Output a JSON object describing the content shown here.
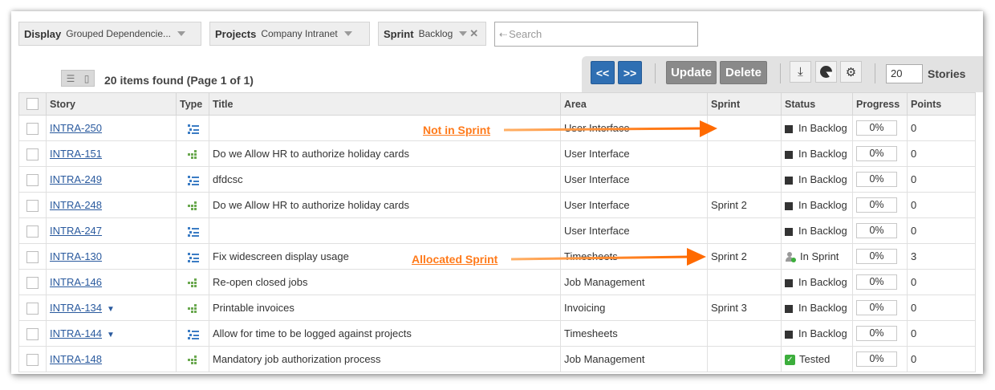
{
  "filters": {
    "display": {
      "label": "Display",
      "value": "Grouped Dependencie..."
    },
    "projects": {
      "label": "Projects",
      "value": "Company Intranet"
    },
    "sprint": {
      "label": "Sprint",
      "value": "Backlog"
    }
  },
  "search": {
    "placeholder": "Search"
  },
  "results": {
    "summary": "20 items found (Page 1 of 1)"
  },
  "toolbar": {
    "prev_label": "<<",
    "next_label": ">>",
    "update_label": "Update",
    "delete_label": "Delete",
    "per_page_value": "20",
    "per_page_unit": "Stories"
  },
  "table": {
    "columns": [
      "Story",
      "Type",
      "Title",
      "Area",
      "Sprint",
      "Status",
      "Progress",
      "Points"
    ],
    "rows": [
      {
        "story": "INTRA-250",
        "type": "list-icon",
        "title": "",
        "area": "User Interface",
        "sprint": "",
        "status": "In Backlog",
        "status_icon": "backlog-square-icon",
        "progress": "0%",
        "points": "0",
        "expand": ""
      },
      {
        "story": "INTRA-151",
        "type": "dependency-icon",
        "title": "Do we Allow HR to authorize holiday cards",
        "area": "User Interface",
        "sprint": "",
        "status": "In Backlog",
        "status_icon": "backlog-square-icon",
        "progress": "0%",
        "points": "0",
        "expand": ""
      },
      {
        "story": "INTRA-249",
        "type": "list-icon",
        "title": "dfdcsc",
        "area": "User Interface",
        "sprint": "",
        "status": "In Backlog",
        "status_icon": "backlog-square-icon",
        "progress": "0%",
        "points": "0",
        "expand": ""
      },
      {
        "story": "INTRA-248",
        "type": "dependency-icon",
        "title": "Do we Allow HR to authorize holiday cards",
        "area": "User Interface",
        "sprint": "Sprint 2",
        "status": "In Backlog",
        "status_icon": "backlog-square-icon",
        "progress": "0%",
        "points": "0",
        "expand": ""
      },
      {
        "story": "INTRA-247",
        "type": "list-icon",
        "title": "",
        "area": "User Interface",
        "sprint": "",
        "status": "In Backlog",
        "status_icon": "backlog-square-icon",
        "progress": "0%",
        "points": "0",
        "expand": ""
      },
      {
        "story": "INTRA-130",
        "type": "list-icon",
        "title": "Fix widescreen display usage",
        "area": "Timesheets",
        "sprint": "Sprint 2",
        "status": "In Sprint",
        "status_icon": "in-sprint-user-icon",
        "progress": "0%",
        "points": "3",
        "expand": ""
      },
      {
        "story": "INTRA-146",
        "type": "dependency-icon",
        "title": "Re-open closed jobs",
        "area": "Job Management",
        "sprint": "",
        "status": "In Backlog",
        "status_icon": "backlog-square-icon",
        "progress": "0%",
        "points": "0",
        "expand": ""
      },
      {
        "story": "INTRA-134",
        "type": "dependency-icon",
        "title": "Printable invoices",
        "area": "Invoicing",
        "sprint": "Sprint 3",
        "status": "In Backlog",
        "status_icon": "backlog-square-icon",
        "progress": "0%",
        "points": "0",
        "expand": "▼"
      },
      {
        "story": "INTRA-144",
        "type": "list-icon",
        "title": "Allow for time to be logged against projects",
        "area": "Timesheets",
        "sprint": "",
        "status": "In Backlog",
        "status_icon": "backlog-square-icon",
        "progress": "0%",
        "points": "0",
        "expand": "▼"
      },
      {
        "story": "INTRA-148",
        "type": "dependency-icon",
        "title": "Mandatory job authorization process",
        "area": "Job Management",
        "sprint": "",
        "status": "Tested",
        "status_icon": "tested-check-icon",
        "progress": "0%",
        "points": "0",
        "expand": ""
      }
    ]
  },
  "annotations": {
    "not_in_sprint": "Not in Sprint",
    "allocated_sprint": "Allocated Sprint"
  },
  "colors": {
    "accent_blue": "#2f6fb3",
    "annotation_orange": "#ff7a1a",
    "link": "#2a5a9e"
  }
}
